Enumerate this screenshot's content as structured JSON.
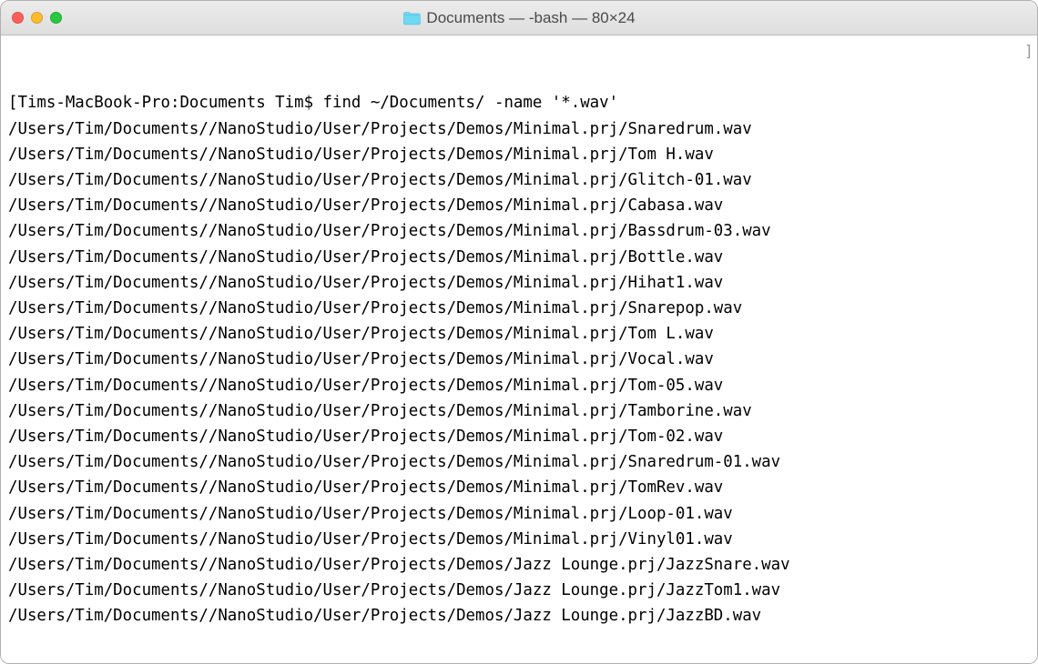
{
  "window": {
    "title": "Documents — -bash — 80×24"
  },
  "terminal": {
    "prompt_open": "[",
    "prompt": "Tims-MacBook-Pro:Documents Tim$ find ~/Documents/ -name '*.wav'",
    "scroll_hint": "]",
    "lines": [
      "/Users/Tim/Documents//NanoStudio/User/Projects/Demos/Minimal.prj/Snaredrum.wav",
      "/Users/Tim/Documents//NanoStudio/User/Projects/Demos/Minimal.prj/Tom H.wav",
      "/Users/Tim/Documents//NanoStudio/User/Projects/Demos/Minimal.prj/Glitch-01.wav",
      "/Users/Tim/Documents//NanoStudio/User/Projects/Demos/Minimal.prj/Cabasa.wav",
      "/Users/Tim/Documents//NanoStudio/User/Projects/Demos/Minimal.prj/Bassdrum-03.wav",
      "/Users/Tim/Documents//NanoStudio/User/Projects/Demos/Minimal.prj/Bottle.wav",
      "/Users/Tim/Documents//NanoStudio/User/Projects/Demos/Minimal.prj/Hihat1.wav",
      "/Users/Tim/Documents//NanoStudio/User/Projects/Demos/Minimal.prj/Snarepop.wav",
      "/Users/Tim/Documents//NanoStudio/User/Projects/Demos/Minimal.prj/Tom L.wav",
      "/Users/Tim/Documents//NanoStudio/User/Projects/Demos/Minimal.prj/Vocal.wav",
      "/Users/Tim/Documents//NanoStudio/User/Projects/Demos/Minimal.prj/Tom-05.wav",
      "/Users/Tim/Documents//NanoStudio/User/Projects/Demos/Minimal.prj/Tamborine.wav",
      "/Users/Tim/Documents//NanoStudio/User/Projects/Demos/Minimal.prj/Tom-02.wav",
      "/Users/Tim/Documents//NanoStudio/User/Projects/Demos/Minimal.prj/Snaredrum-01.wav",
      "/Users/Tim/Documents//NanoStudio/User/Projects/Demos/Minimal.prj/TomRev.wav",
      "/Users/Tim/Documents//NanoStudio/User/Projects/Demos/Minimal.prj/Loop-01.wav",
      "/Users/Tim/Documents//NanoStudio/User/Projects/Demos/Minimal.prj/Vinyl01.wav",
      "/Users/Tim/Documents//NanoStudio/User/Projects/Demos/Jazz Lounge.prj/JazzSnare.wav",
      "/Users/Tim/Documents//NanoStudio/User/Projects/Demos/Jazz Lounge.prj/JazzTom1.wav",
      "/Users/Tim/Documents//NanoStudio/User/Projects/Demos/Jazz Lounge.prj/JazzBD.wav"
    ]
  }
}
